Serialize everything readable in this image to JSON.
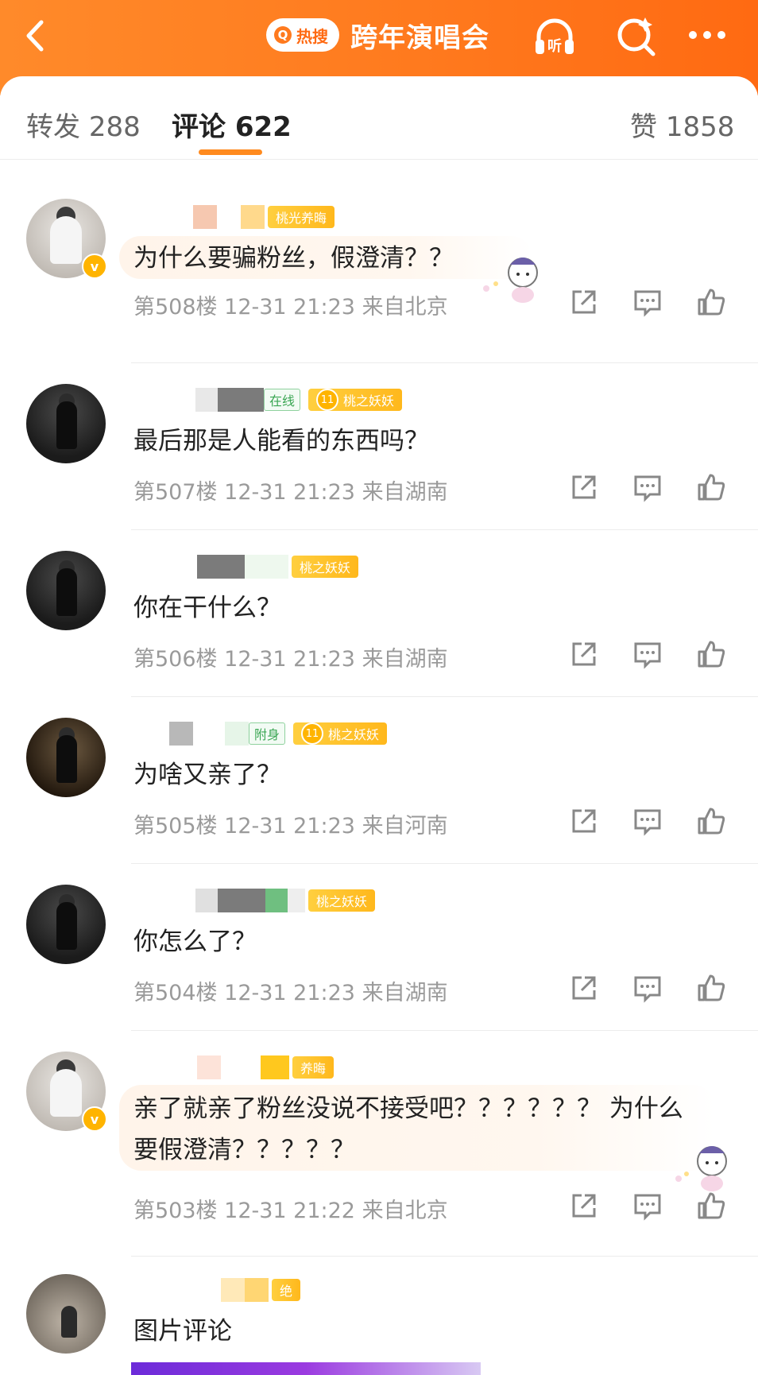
{
  "header": {
    "hot_search_label": "热搜",
    "title": "跨年演唱会",
    "listen_label": "听"
  },
  "tabs": [
    {
      "label": "转发",
      "count": "288"
    },
    {
      "label": "评论",
      "count": "622"
    },
    {
      "label": "赞",
      "count": "1858"
    }
  ],
  "comments": [
    {
      "badge": "桃光养晦",
      "text": "为什么要骗粉丝，假澄清？？",
      "floor": "第508楼",
      "time": "12-31 21:23",
      "location": "来自北京"
    },
    {
      "tag": "在线",
      "level": "11",
      "badge": "桃之妖妖",
      "text": "最后那是人能看的东西吗？",
      "floor": "第507楼",
      "time": "12-31 21:23",
      "location": "来自湖南"
    },
    {
      "badge": "桃之妖妖",
      "text": "你在干什么？",
      "floor": "第506楼",
      "time": "12-31 21:23",
      "location": "来自湖南"
    },
    {
      "tag": "附身",
      "level": "11",
      "badge": "桃之妖妖",
      "text": "为啥又亲了？",
      "floor": "第505楼",
      "time": "12-31 21:23",
      "location": "来自河南"
    },
    {
      "badge": "桃之妖妖",
      "text": "你怎么了？",
      "floor": "第504楼",
      "time": "12-31 21:23",
      "location": "来自湖南"
    },
    {
      "badge": "养晦",
      "text_line1": "亲了就亲了粉丝没说不接受吧？？？？？？ 为什么",
      "text_line2": "要假澄清？？？？？",
      "floor": "第503楼",
      "time": "12-31 21:22",
      "location": "来自北京"
    },
    {
      "badge": "绝",
      "text": "图片评论"
    }
  ],
  "colors": {
    "accent": "#ff8a1e",
    "badge_gold": "#ffb81c",
    "meta_gray": "#9a9a9a"
  },
  "icons": [
    "back-icon",
    "listen-icon",
    "search-icon",
    "more-icon",
    "share-icon",
    "comment-icon",
    "like-icon",
    "verified-icon"
  ]
}
